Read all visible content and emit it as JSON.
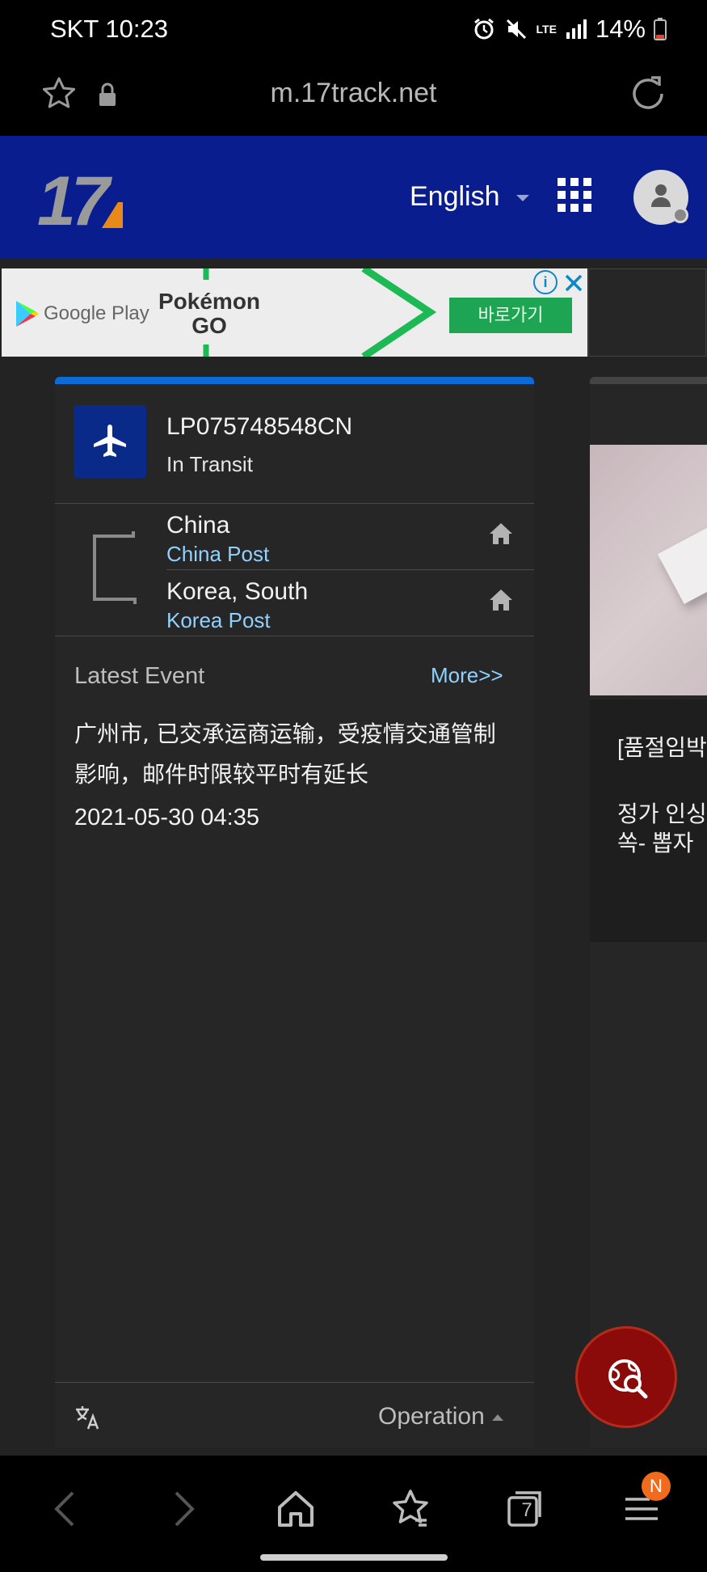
{
  "status_bar": {
    "carrier": "SKT",
    "time": "10:23",
    "network": "LTE",
    "battery": "14%"
  },
  "browser": {
    "url": "m.17track.net"
  },
  "site_header": {
    "logo": "17",
    "language": "English"
  },
  "ad": {
    "store_label": "Google Play",
    "title_line1": "Pokémon",
    "title_line2": "GO",
    "cta": "바로가기"
  },
  "shipment": {
    "tracking_number": "LP075748548CN",
    "status": "In Transit",
    "origin": {
      "country": "China",
      "carrier": "China Post"
    },
    "destination": {
      "country": "Korea, South",
      "carrier": "Korea Post"
    }
  },
  "latest_event": {
    "heading": "Latest Event",
    "more_link": "More>>",
    "description": "广州市, 已交承运商运输，受疫情交通管制影响，邮件时限较平时有延长",
    "datetime": "2021-05-30 04:35"
  },
  "footer": {
    "operation_label": "Operation"
  },
  "side_card": {
    "line1": "[품절임박",
    "line2": "정가 인싱",
    "line3": "쏙- 뽑자"
  },
  "bottom_nav": {
    "tabs_count": "7",
    "menu_badge": "N"
  },
  "colors": {
    "header_bg": "#0a1d8f",
    "accent_blue": "#0d6bd8",
    "link_blue": "#8fd1ff",
    "fab_red": "#8b0a0a"
  }
}
